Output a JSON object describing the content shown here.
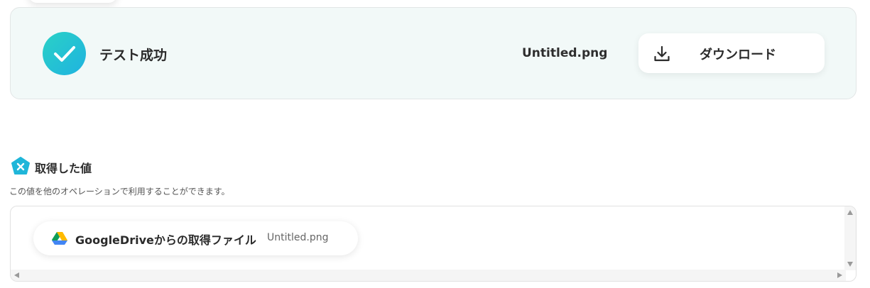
{
  "result": {
    "status_label": "テスト成功",
    "status_icon": "check-icon",
    "file_name": "Untitled.png",
    "download_label": "ダウンロード",
    "download_icon": "download-icon"
  },
  "section": {
    "title": "取得した値",
    "icon": "yoom-logo-icon",
    "description": "この値を他のオペレーションで利用することができます。"
  },
  "values": [
    {
      "icon": "google-drive-icon",
      "label": "GoogleDriveからの取得ファイル",
      "value": "Untitled.png"
    }
  ],
  "colors": {
    "accent_gradient_start": "#2ad1c6",
    "accent_gradient_end": "#1fb3e0",
    "card_background": "#f2f9f8"
  }
}
